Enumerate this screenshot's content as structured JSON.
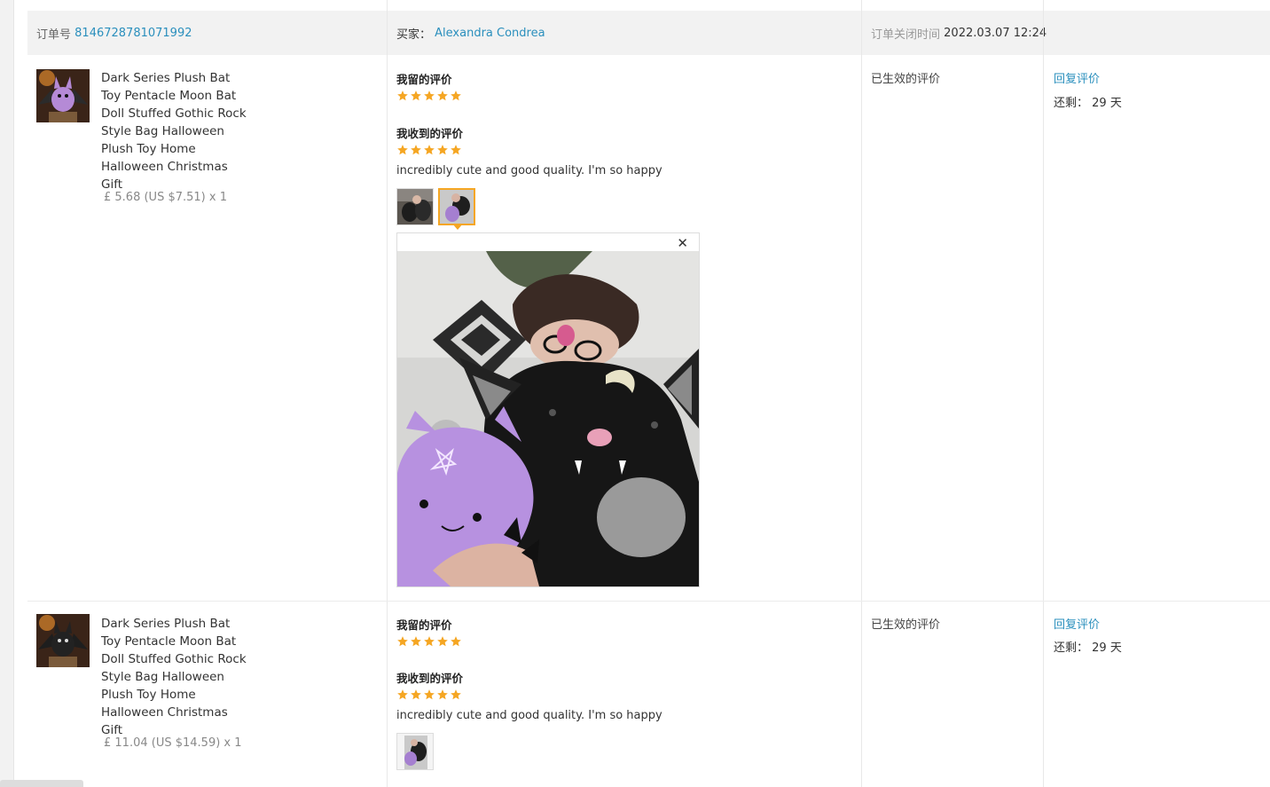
{
  "order": {
    "number_label": "订单号",
    "number": "8146728781071992",
    "buyer_label": "买家：",
    "buyer": "Alexandra Condrea",
    "closed_label": "订单关闭时间",
    "closed_time": "2022.03.07 12:24"
  },
  "items": [
    {
      "title": "Dark Series Plush Bat Toy Pentacle Moon Bat Doll Stuffed Gothic Rock Style Bag Halloween Plush Toy Home Halloween Christmas Gift",
      "price": "£ 5.68 (US $7.51) x 1",
      "my_review_label": "我留的评价",
      "my_rating": 5,
      "received_review_label": "我收到的评价",
      "received_rating": 5,
      "review_text": "incredibly cute and good quality. I'm so happy",
      "status": "已生效的评价",
      "reply_label": "回复评价",
      "remaining_label": "还剩：",
      "remaining_value": "29 天"
    },
    {
      "title": "Dark Series Plush Bat Toy Pentacle Moon Bat Doll Stuffed Gothic Rock Style Bag Halloween Plush Toy Home Halloween Christmas Gift",
      "price": "£ 11.04 (US $14.59) x 1",
      "my_review_label": "我留的评价",
      "my_rating": 5,
      "received_review_label": "我收到的评价",
      "received_rating": 5,
      "review_text": "incredibly cute and good quality. I'm so happy",
      "status": "已生效的评价",
      "reply_label": "回复评价",
      "remaining_label": "还剩：",
      "remaining_value": "29 天"
    }
  ],
  "preview": {
    "close_icon": "close-icon"
  },
  "colors": {
    "link": "#2a8fbd",
    "star": "#f5a623",
    "header_bg": "#f2f2f2"
  }
}
